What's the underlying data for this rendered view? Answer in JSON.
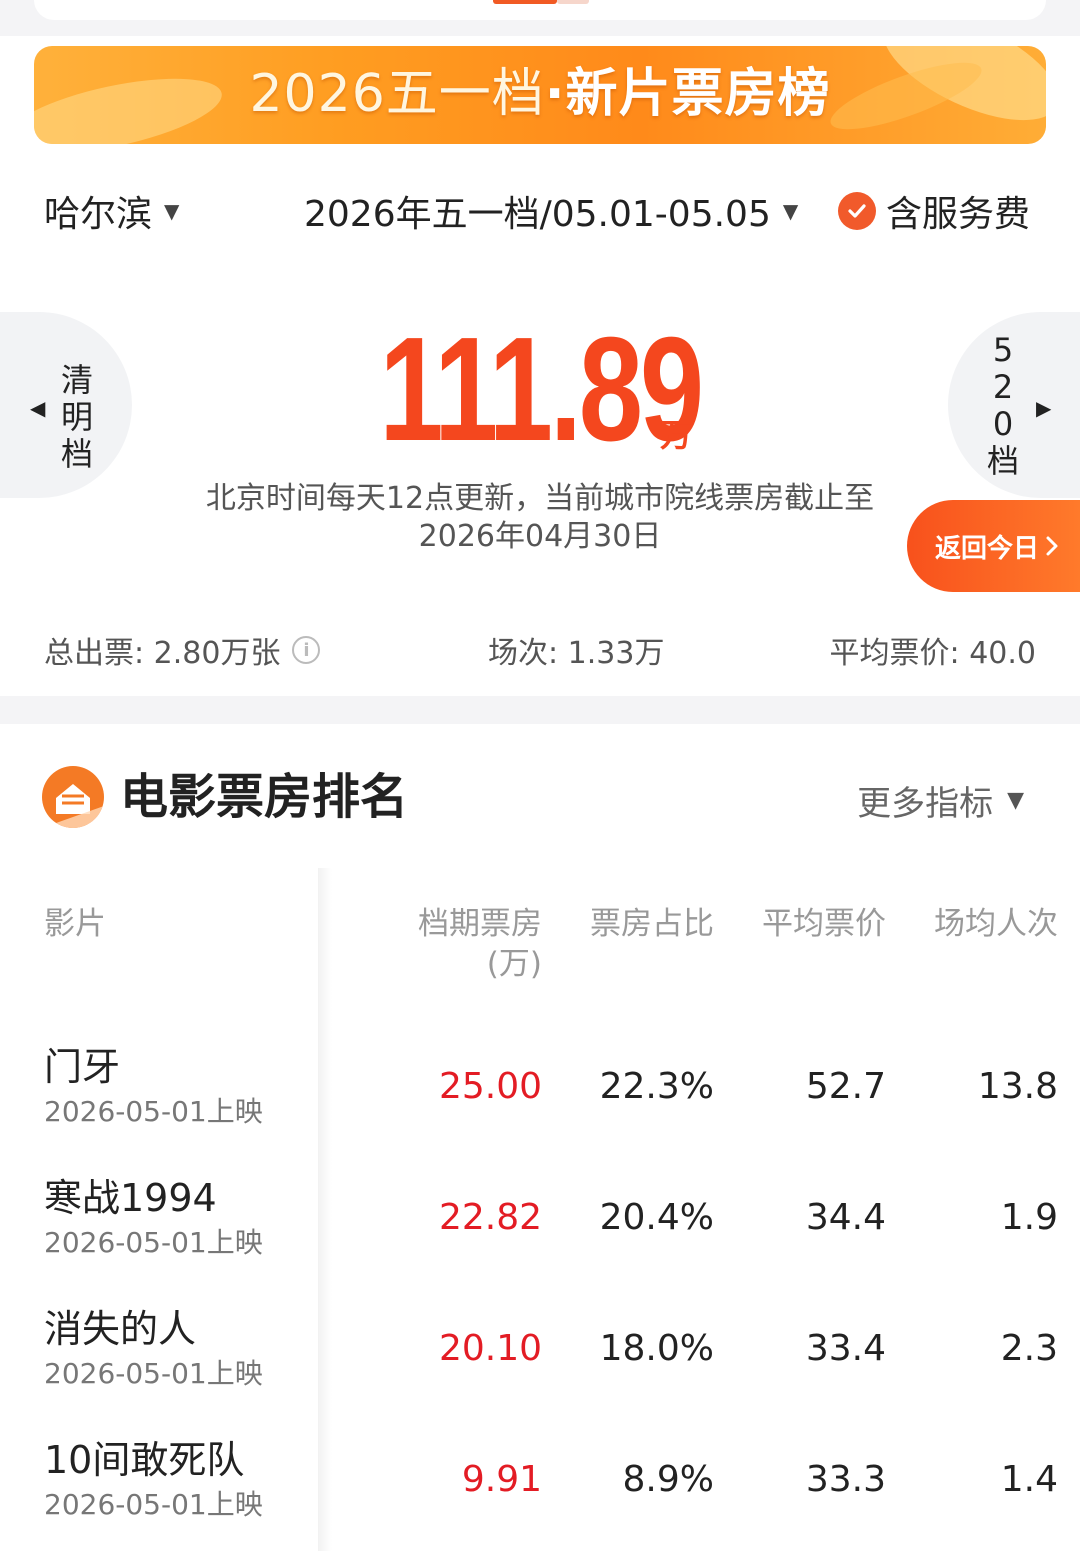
{
  "banner": {
    "year": "2026五一档",
    "dot": "·",
    "title": "新片票房榜"
  },
  "filters": {
    "city": "哈尔滨",
    "period": "2026年五一档/05.01-05.05",
    "service_fee": "含服务费"
  },
  "nav": {
    "prev": [
      "清",
      "明",
      "档"
    ],
    "next": [
      "5",
      "2",
      "0",
      "档"
    ]
  },
  "total": {
    "value": "111.89",
    "unit": "万"
  },
  "update_note": {
    "line1": "北京时间每天12点更新，当前城市院线票房截止至",
    "line2": "2026年04月30日"
  },
  "back_today": "返回今日",
  "stats": {
    "tickets": "总出票: 2.80万张",
    "shows": "场次: 1.33万",
    "avg_price": "平均票价: 40.0"
  },
  "section": {
    "title": "电影票房排名",
    "more": "更多指标"
  },
  "table": {
    "headers": {
      "film": "影片",
      "box_office": "档期票房",
      "box_office_unit": "(万)",
      "share": "票房占比",
      "avg_price": "平均票价",
      "per_show": "场均人次"
    },
    "rows": [
      {
        "name": "门牙",
        "date": "2026-05-01上映",
        "box": "25.00",
        "share": "22.3%",
        "avg": "52.7",
        "per": "13.8"
      },
      {
        "name": "寒战1994",
        "date": "2026-05-01上映",
        "box": "22.82",
        "share": "20.4%",
        "avg": "34.4",
        "per": "1.9"
      },
      {
        "name": "消失的人",
        "date": "2026-05-01上映",
        "box": "20.10",
        "share": "18.0%",
        "avg": "33.4",
        "per": "2.3"
      },
      {
        "name": "10间敢死队",
        "date": "2026-05-01上映",
        "box": "9.91",
        "share": "8.9%",
        "avg": "33.3",
        "per": "1.4"
      }
    ]
  },
  "colors": {
    "accent": "#f4471e",
    "banner": "#ff9d21",
    "red_value": "#e31c24"
  }
}
